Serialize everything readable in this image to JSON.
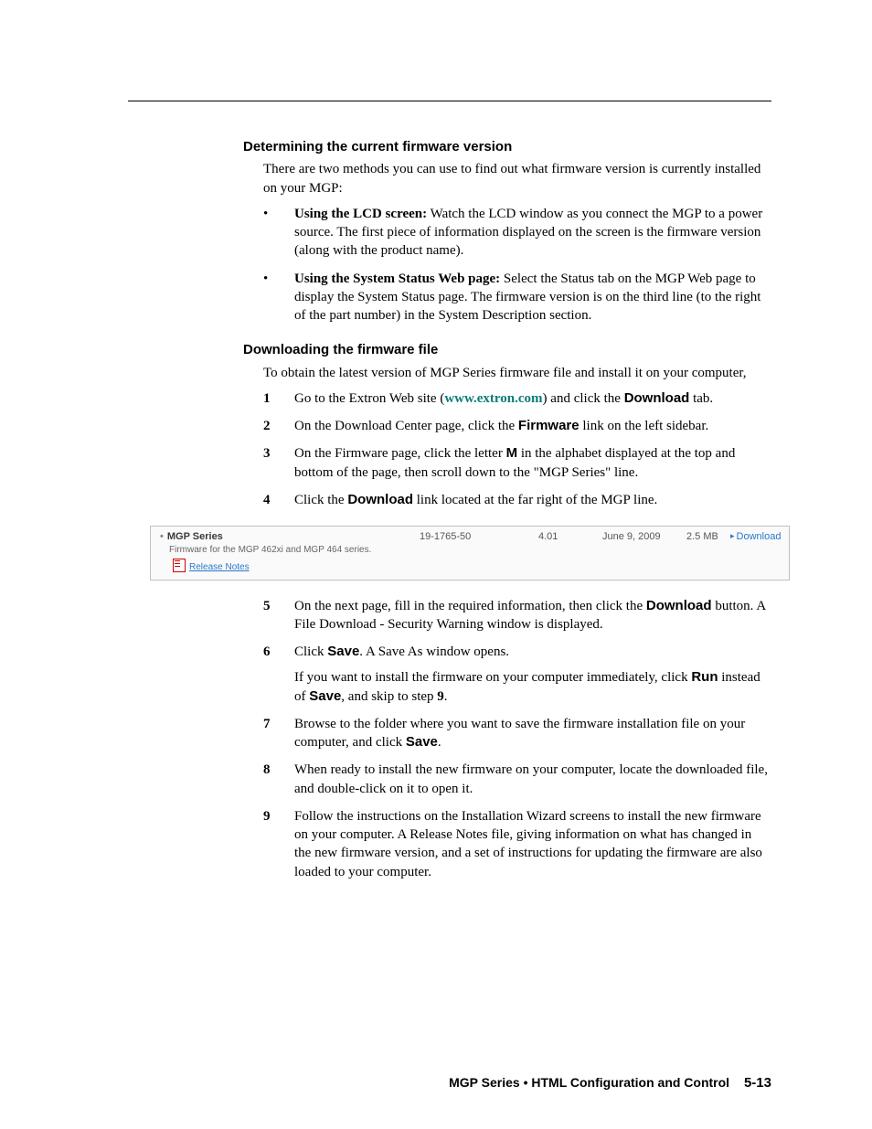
{
  "section1": {
    "heading": "Determining the current firmware version",
    "intro": "There are two methods you can use to find out what firmware version is currently installed on your MGP:",
    "b1_lead": "Using the LCD screen:",
    "b1_text": " Watch the LCD window as you connect the MGP to a power source.  The first piece of information displayed on the screen is the firmware version (along with the product name).",
    "b2_lead": "Using the System Status Web page:",
    "b2_text": " Select the Status tab on the MGP Web page to display the System Status page.  The firmware version is on the third line (to the right of the part number) in the System Description section."
  },
  "section2": {
    "heading": "Downloading the firmware file",
    "intro": "To obtain the latest version of MGP Series firmware file and install it on your computer,",
    "s1a": "Go to the Extron Web site (",
    "s1_url": "www.extron.com",
    "s1b": ") and click the ",
    "s1_bold": "Download",
    "s1c": " tab.",
    "s2a": "On the Download Center page, click the ",
    "s2_bold": "Firmware",
    "s2b": " link on the left sidebar.",
    "s3a": "On the Firmware page, click the letter ",
    "s3_bold": "M",
    "s3b": " in the alphabet displayed at the top and bottom of the page, then scroll down to the \"MGP Series\" line.",
    "s4a": "Click the ",
    "s4_bold": "Download",
    "s4b": " link located at the far right of the MGP line.",
    "s5a": "On the next page, fill in the required information, then click the ",
    "s5_bold": "Download",
    "s5b": " button.  A File Download - Security Warning window is displayed.",
    "s6a": "Click ",
    "s6_bold": "Save",
    "s6b": ".  A Save As window opens.",
    "s6_p2a": "If you want to install the firmware on your computer immediately, click ",
    "s6_p2_run": "Run",
    "s6_p2b": " instead of ",
    "s6_p2_save": "Save",
    "s6_p2c": ", and skip to step ",
    "s6_p2_step": "9",
    "s6_p2d": ".",
    "s7a": "Browse to the folder where you want to save the firmware installation file on your computer, and click ",
    "s7_bold": "Save",
    "s7b": ".",
    "s8": "When ready to install the new firmware on your computer, locate the downloaded file, and double-click on it to open it.",
    "s9": "Follow the instructions on the Installation Wizard screens to install the new firmware on your computer.  A Release Notes file, giving information on what has changed in the new firmware version, and a set of instructions for updating the firmware are also loaded to your computer."
  },
  "screenshot": {
    "title": "MGP Series",
    "desc": "Firmware for the MGP 462xi and MGP 464 series.",
    "notes": "Release Notes",
    "part": "19-1765-50",
    "ver": "4.01",
    "date": "June 9, 2009",
    "size": "2.5 MB",
    "download": "Download"
  },
  "footer": {
    "text": "MGP Series • HTML Configuration and Control",
    "page": "5-13"
  },
  "nums": {
    "n1": "1",
    "n2": "2",
    "n3": "3",
    "n4": "4",
    "n5": "5",
    "n6": "6",
    "n7": "7",
    "n8": "8",
    "n9": "9"
  }
}
